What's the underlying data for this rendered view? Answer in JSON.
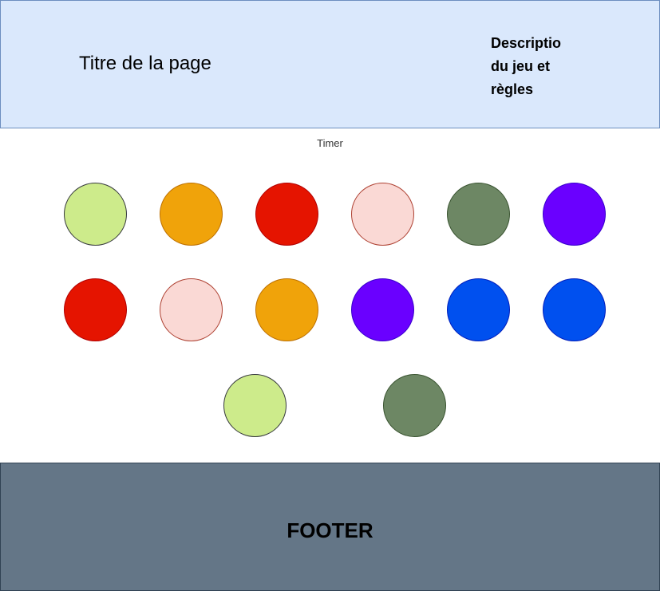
{
  "header": {
    "title": "Titre de la page",
    "description": "Descriptio\ndu jeu et\nrègles"
  },
  "timer": {
    "label": "Timer"
  },
  "board": {
    "rows": [
      [
        {
          "fill": "#cdeb8b",
          "stroke": "#36393d"
        },
        {
          "fill": "#f0a30a",
          "stroke": "#bd7000"
        },
        {
          "fill": "#e51400",
          "stroke": "#b20000"
        },
        {
          "fill": "#fad9d5",
          "stroke": "#ae4132"
        },
        {
          "fill": "#6d8764",
          "stroke": "#3a5431"
        },
        {
          "fill": "#6a00ff",
          "stroke": "#3700cc"
        }
      ],
      [
        {
          "fill": "#e51400",
          "stroke": "#b20000"
        },
        {
          "fill": "#fad9d5",
          "stroke": "#ae4132"
        },
        {
          "fill": "#f0a30a",
          "stroke": "#bd7000"
        },
        {
          "fill": "#6a00ff",
          "stroke": "#3700cc"
        },
        {
          "fill": "#0050ef",
          "stroke": "#001dbc"
        },
        {
          "fill": "#0050ef",
          "stroke": "#001dbc"
        }
      ],
      [
        {
          "fill": "#cdeb8b",
          "stroke": "#36393d"
        },
        {
          "fill": "#6d8764",
          "stroke": "#3a5431"
        }
      ]
    ]
  },
  "footer": {
    "label": "FOOTER"
  }
}
